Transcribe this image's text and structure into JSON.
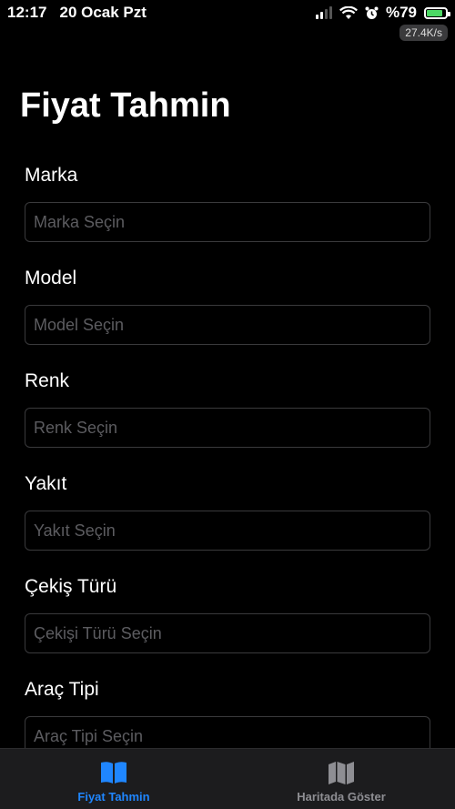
{
  "status": {
    "time": "12:17",
    "date": "20 Ocak Pzt",
    "battery": "%79",
    "battery_level": 0.79,
    "network_speed": "27.4K/s"
  },
  "page": {
    "title": "Fiyat Tahmin"
  },
  "form": {
    "fields": [
      {
        "label": "Marka",
        "placeholder": "Marka Seçin"
      },
      {
        "label": "Model",
        "placeholder": "Model Seçin"
      },
      {
        "label": "Renk",
        "placeholder": "Renk Seçin"
      },
      {
        "label": "Yakıt",
        "placeholder": "Yakıt Seçin"
      },
      {
        "label": "Çekiş Türü",
        "placeholder": "Çekişi Türü Seçin"
      },
      {
        "label": "Araç Tipi",
        "placeholder": "Araç Tipi Seçin"
      }
    ]
  },
  "tabs": [
    {
      "label": "Fiyat Tahmin",
      "icon": "book-icon",
      "active": true
    },
    {
      "label": "Haritada Göster",
      "icon": "map-icon",
      "active": false
    }
  ],
  "colors": {
    "accent": "#1f86ff",
    "inactive": "#8e8e93",
    "background": "#000000"
  }
}
